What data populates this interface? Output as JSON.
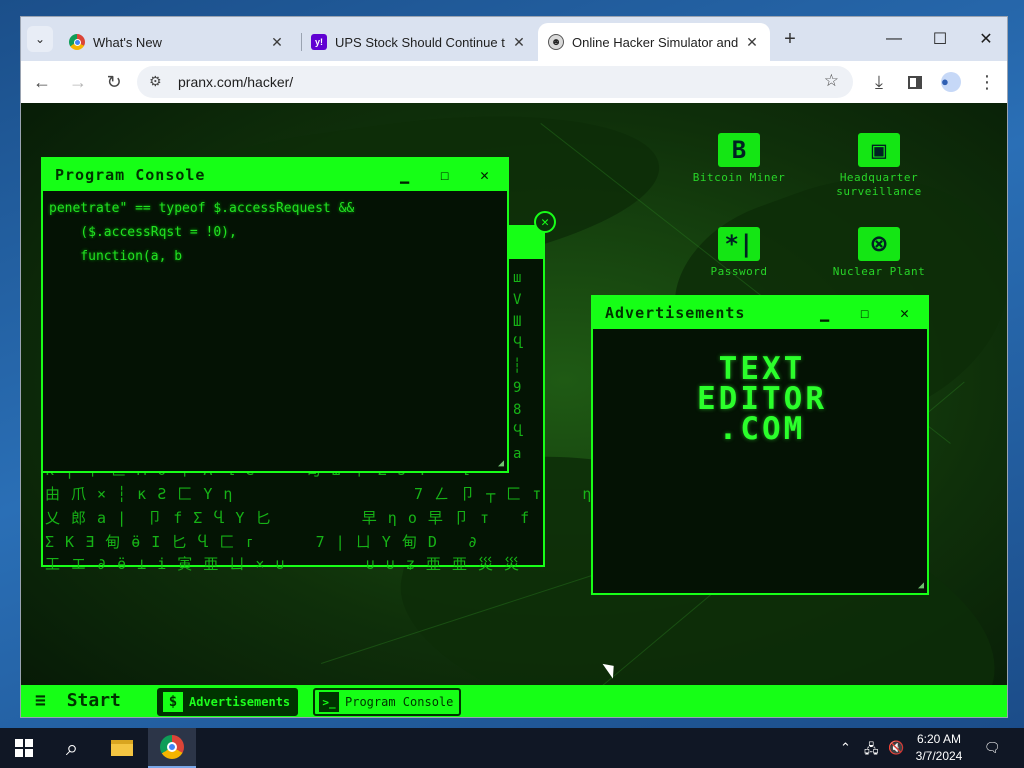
{
  "browser": {
    "tabs": [
      {
        "title": "What's New",
        "favicon": "chrome-icon",
        "active": false
      },
      {
        "title": "UPS Stock Should Continue to G",
        "favicon": "yahoo-icon",
        "active": false
      },
      {
        "title": "Online Hacker Simulator and Ty",
        "favicon": "pranx-icon",
        "active": true
      }
    ],
    "new_tab_label": "+",
    "url": "pranx.com/hacker/"
  },
  "hacker": {
    "program_console": {
      "title": "Program Console",
      "code_lines": [
        "penetrate\" == typeof $.accessRequest &&",
        "    ($.accessRqst = !0),",
        "    function(a, b"
      ]
    },
    "matrix_rows": [
      "k | 千 匚 м θ 千 Λ Ⴁ е     甸 ш 早 Σ Ĵ Y   Ⴁ",
      "由 爪 × ┆ к Ƨ 匚 Y η                  7 ㄥ 卩 ┬ 匚 т    η",
      "乂 郎 а |  卩 f Σ Ⴁ Y 匕         早 η ο 早 卩 т   f",
      "Σ К Ǝ 甸 ӫ I 匕 Ⴁ 匚 ᴦ      7 | ㄩ Y 甸 D   ∂",
      "工 エ ∂ ӫ ⊥ і 寅 亜 ㄩ × ∪        ∪ ∪ ʑ 亜 亜 災 災"
    ],
    "advertisements": {
      "title": "Advertisements",
      "logo_lines": [
        "TEXT",
        "EDITOR",
        ".COM"
      ]
    },
    "desktop_icons": [
      {
        "label": "Bitcoin Miner",
        "icon": "bitcoin-icon",
        "glyph": "B"
      },
      {
        "label": "Headquarter surveillance",
        "icon": "surveillance-icon",
        "glyph": "▣"
      },
      {
        "label": "Password",
        "icon": "password-icon",
        "glyph": "*|"
      },
      {
        "label": "Nuclear Plant",
        "icon": "nuclear-icon",
        "glyph": "⊗"
      }
    ],
    "taskbar": {
      "start_label": "Start",
      "items": [
        {
          "label": "Advertisements",
          "icon_glyph": "$",
          "active": true
        },
        {
          "label": "Program Console",
          "icon_glyph": ">_",
          "active": false
        }
      ]
    },
    "colors": {
      "accent": "#16ff16",
      "text": "#22e022",
      "background": "#041204"
    }
  },
  "windows": {
    "clock_time": "6:20 AM",
    "clock_date": "3/7/2024"
  }
}
